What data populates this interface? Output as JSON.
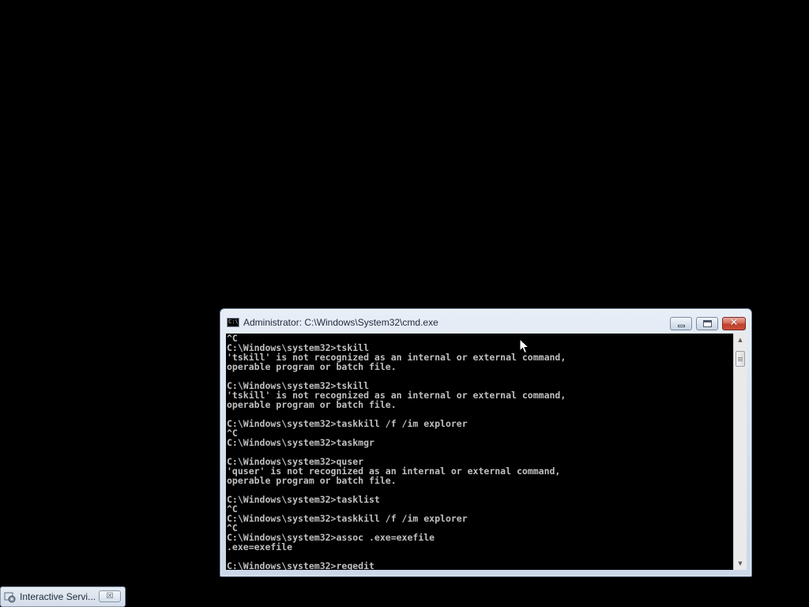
{
  "window": {
    "title": "Administrator: C:\\Windows\\System32\\cmd.exe",
    "icon_label": "C:\\",
    "minimize_icon": "minimize-icon",
    "maximize_icon": "maximize-icon",
    "close_glyph": "✕"
  },
  "console": {
    "lines": [
      "^C",
      "C:\\Windows\\system32>tskill",
      "'tskill' is not recognized as an internal or external command,",
      "operable program or batch file.",
      "",
      "C:\\Windows\\system32>tskill",
      "'tskill' is not recognized as an internal or external command,",
      "operable program or batch file.",
      "",
      "C:\\Windows\\system32>taskkill /f /im explorer",
      "^C",
      "C:\\Windows\\system32>taskmgr",
      "",
      "C:\\Windows\\system32>quser",
      "'quser' is not recognized as an internal or external command,",
      "operable program or batch file.",
      "",
      "C:\\Windows\\system32>tasklist",
      "^C",
      "C:\\Windows\\system32>taskkill /f /im explorer",
      "^C",
      "C:\\Windows\\system32>assoc .exe=exefile",
      ".exe=exefile",
      "",
      "C:\\Windows\\system32>regedit"
    ],
    "text_color": "#c0c0c0",
    "background_color": "#000000"
  },
  "scrollbar": {
    "up_glyph": "▲",
    "down_glyph": "▼"
  },
  "minimized": {
    "title": "Interactive Servi...",
    "close_glyph": "☒",
    "icon": "service-gear-icon"
  }
}
